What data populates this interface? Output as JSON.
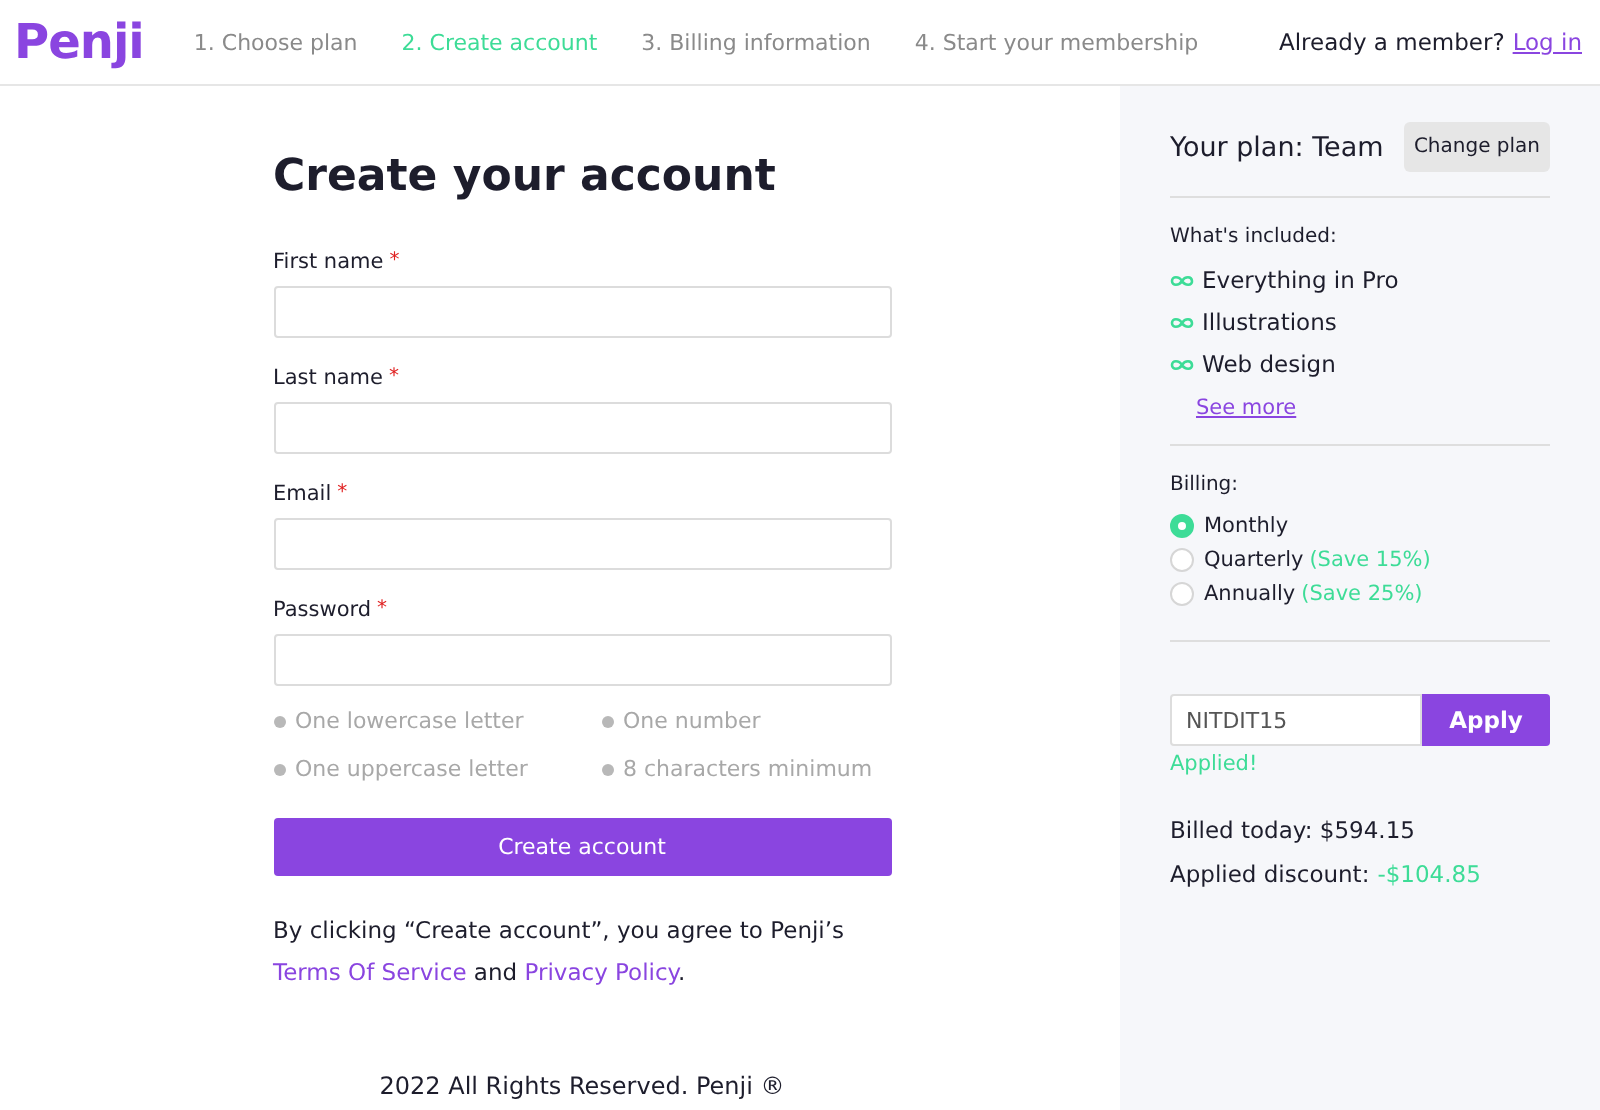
{
  "header": {
    "logo": "Penji",
    "steps": [
      {
        "label": "1. Choose plan",
        "selected": false
      },
      {
        "label": "2. Create account",
        "selected": true
      },
      {
        "label": "3. Billing information",
        "selected": false
      },
      {
        "label": "4. Start your membership",
        "selected": false
      }
    ],
    "member_prompt": "Already a member?",
    "login_link": "Log in"
  },
  "form": {
    "title": "Create your account",
    "fields": [
      {
        "label": "First name",
        "required_mark": "*"
      },
      {
        "label": "Last name",
        "required_mark": "*"
      },
      {
        "label": "Email",
        "required_mark": "*"
      },
      {
        "label": "Password",
        "required_mark": "*"
      }
    ],
    "password_rules": [
      "One lowercase letter",
      "One number",
      "One uppercase letter",
      "8 characters minimum"
    ],
    "submit": "Create account",
    "agreement": {
      "text": "By clicking “Create account”, you agree to Penji’s",
      "terms_link": "Terms Of Service",
      "joiner": "and",
      "privacy_link": "Privacy Policy",
      "end": "."
    }
  },
  "footer": "2022 All Rights Reserved. Penji ®",
  "sidebar": {
    "plan_title": "Your plan: Team",
    "change_plan": "Change plan",
    "included_label": "What's included:",
    "features": [
      "Everything in Pro",
      "Illustrations",
      "Web design"
    ],
    "see_more": "See more",
    "billing_label": "Billing:",
    "billing_options": [
      {
        "label": "Monthly",
        "selected": true
      },
      {
        "label": "Quarterly",
        "saving": "(Save 15%)",
        "selected": false
      },
      {
        "label": "Annually",
        "saving": "(Save 25%)",
        "selected": false
      }
    ],
    "promo": {
      "value": "NITDIT15",
      "button": "Apply",
      "status": "Applied!"
    },
    "billed_today": "Billed today: $594.15",
    "discount_label": "Applied discount:",
    "discount_value": "-$104.85"
  }
}
